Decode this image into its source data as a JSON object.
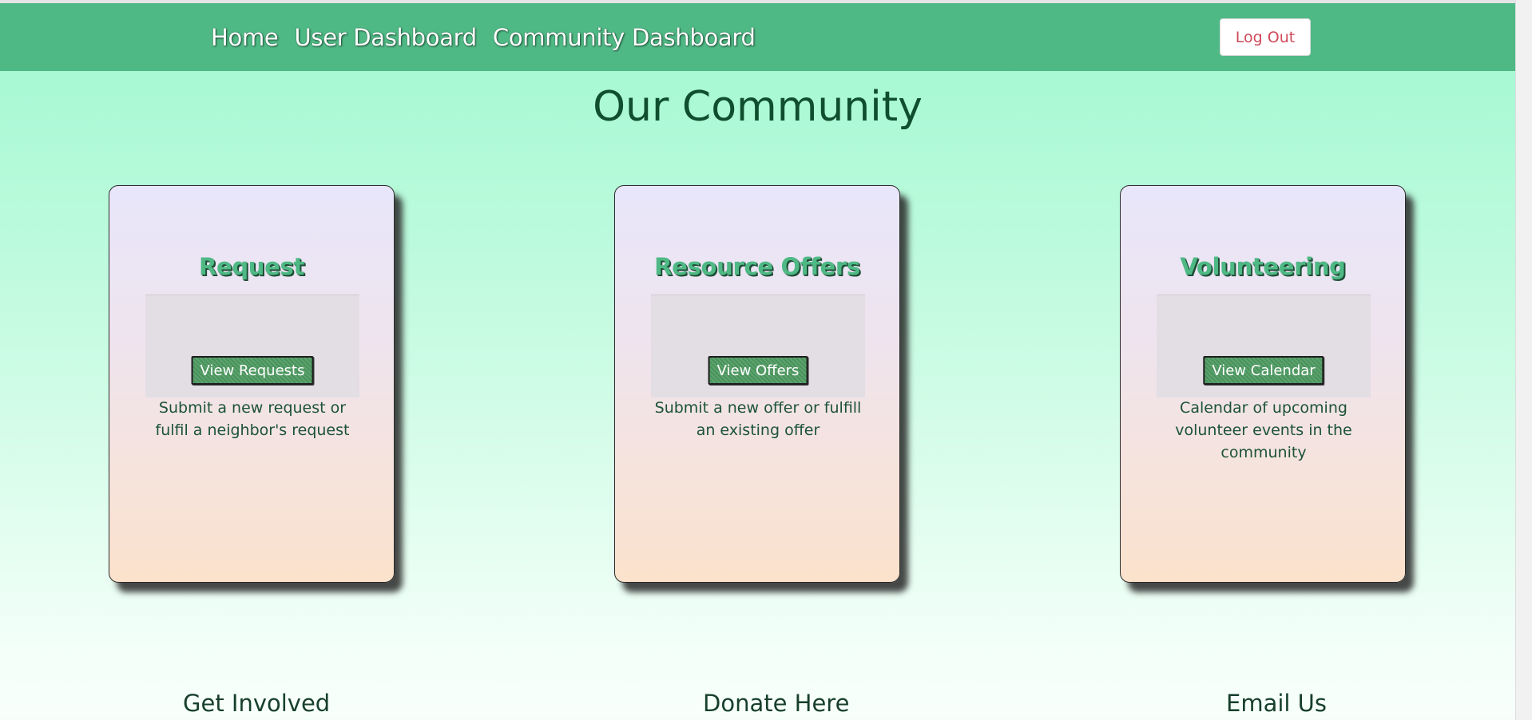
{
  "nav": {
    "links": [
      "Home",
      "User Dashboard",
      "Community Dashboard"
    ],
    "logout_label": "Log Out"
  },
  "page_title": "Our Community",
  "cards": [
    {
      "title": "Request",
      "button_label": "View Requests",
      "description": "Submit a new request or fulfil a neighbor's request"
    },
    {
      "title": "Resource Offers",
      "button_label": "View Offers",
      "description": "Submit a new offer or fulfill an existing offer"
    },
    {
      "title": "Volunteering",
      "button_label": "View Calendar",
      "description": "Calendar of upcoming volunteer events in the community"
    }
  ],
  "footer": {
    "links": [
      "Get Involved",
      "Donate Here",
      "Email Us"
    ]
  },
  "colors": {
    "navbar": "#4fb985",
    "title_text": "#104f2e",
    "logout_text": "#d04a5a",
    "card_title": "#4fb985"
  }
}
